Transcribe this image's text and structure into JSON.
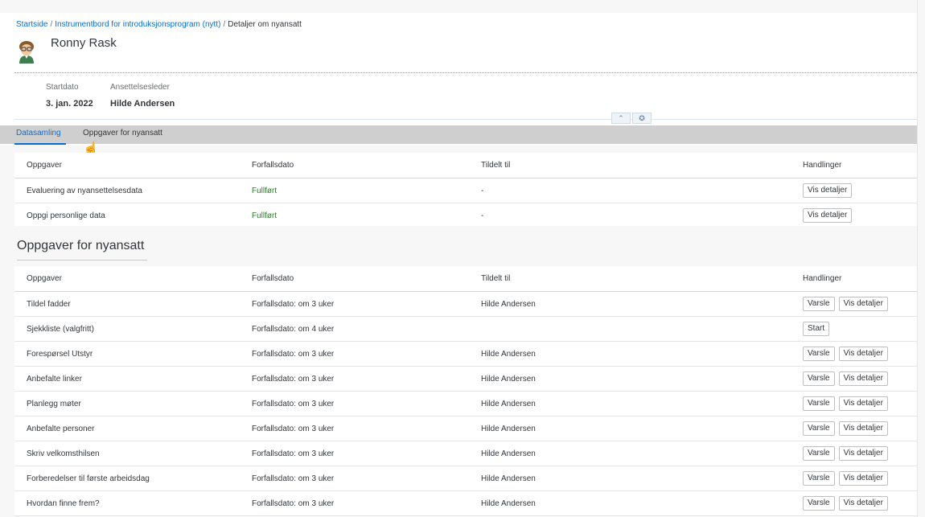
{
  "breadcrumb": {
    "home": "Startside",
    "dashboard": "Instrumentbord for introduksjonsprogram (nytt)",
    "current": "Detaljer om nyansatt",
    "separator": "/"
  },
  "person": {
    "name": "Ronny Rask"
  },
  "attributes": [
    {
      "label": "Startdato",
      "value": "3. jan. 2022"
    },
    {
      "label": "Ansettelsesleder",
      "value": "Hilde Andersen"
    }
  ],
  "tabs": [
    {
      "label": "Datasamling",
      "active": true
    },
    {
      "label": "Oppgaver for nyansatt",
      "active": false
    }
  ],
  "table1": {
    "headers": [
      "Oppgaver",
      "Forfallsdato",
      "Tildelt til",
      "Handlinger"
    ],
    "rows": [
      {
        "task": "Evaluering av nyansettelsesdata",
        "due": "Fullført",
        "assigned": "-",
        "actions": [
          "Vis detaljer"
        ]
      },
      {
        "task": "Oppgi personlige data",
        "due": "Fullført",
        "assigned": "-",
        "actions": [
          "Vis detaljer"
        ]
      }
    ]
  },
  "section": {
    "title": "Oppgaver for nyansatt"
  },
  "table2": {
    "headers": [
      "Oppgaver",
      "Forfallsdato",
      "Tildelt til",
      "Handlinger"
    ],
    "rows": [
      {
        "task": "Tildel fadder",
        "due": "Forfallsdato: om 3 uker",
        "assigned": "Hilde Andersen",
        "actions": [
          "Varsle",
          "Vis detaljer"
        ]
      },
      {
        "task": "Sjekkliste (valgfritt)",
        "due": "Forfallsdato: om 4 uker",
        "assigned": "",
        "actions": [
          "Start"
        ]
      },
      {
        "task": "Forespørsel Utstyr",
        "due": "Forfallsdato: om 3 uker",
        "assigned": "Hilde Andersen",
        "actions": [
          "Varsle",
          "Vis detaljer"
        ]
      },
      {
        "task": "Anbefalte linker",
        "due": "Forfallsdato: om 3 uker",
        "assigned": "Hilde Andersen",
        "actions": [
          "Varsle",
          "Vis detaljer"
        ]
      },
      {
        "task": "Planlegg møter",
        "due": "Forfallsdato: om 3 uker",
        "assigned": "Hilde Andersen",
        "actions": [
          "Varsle",
          "Vis detaljer"
        ]
      },
      {
        "task": "Anbefalte personer",
        "due": "Forfallsdato: om 3 uker",
        "assigned": "Hilde Andersen",
        "actions": [
          "Varsle",
          "Vis detaljer"
        ]
      },
      {
        "task": "Skriv velkomsthilsen",
        "due": "Forfallsdato: om 3 uker",
        "assigned": "Hilde Andersen",
        "actions": [
          "Varsle",
          "Vis detaljer"
        ]
      },
      {
        "task": "Forberedelser til første arbeidsdag",
        "due": "Forfallsdato: om 3 uker",
        "assigned": "Hilde Andersen",
        "actions": [
          "Varsle",
          "Vis detaljer"
        ]
      },
      {
        "task": "Hvordan finne frem?",
        "due": "Forfallsdato: om 3 uker",
        "assigned": "Hilde Andersen",
        "actions": [
          "Varsle",
          "Vis detaljer"
        ]
      }
    ]
  },
  "icons": {
    "collapse": "chevron-up-icon",
    "pin": "pin-icon",
    "avatar": "avatar",
    "cursor": "hand-cursor-icon"
  },
  "colors": {
    "link": "#0a6ed1",
    "success": "#2b7c2b",
    "tabbar": "#cfcfcf"
  }
}
